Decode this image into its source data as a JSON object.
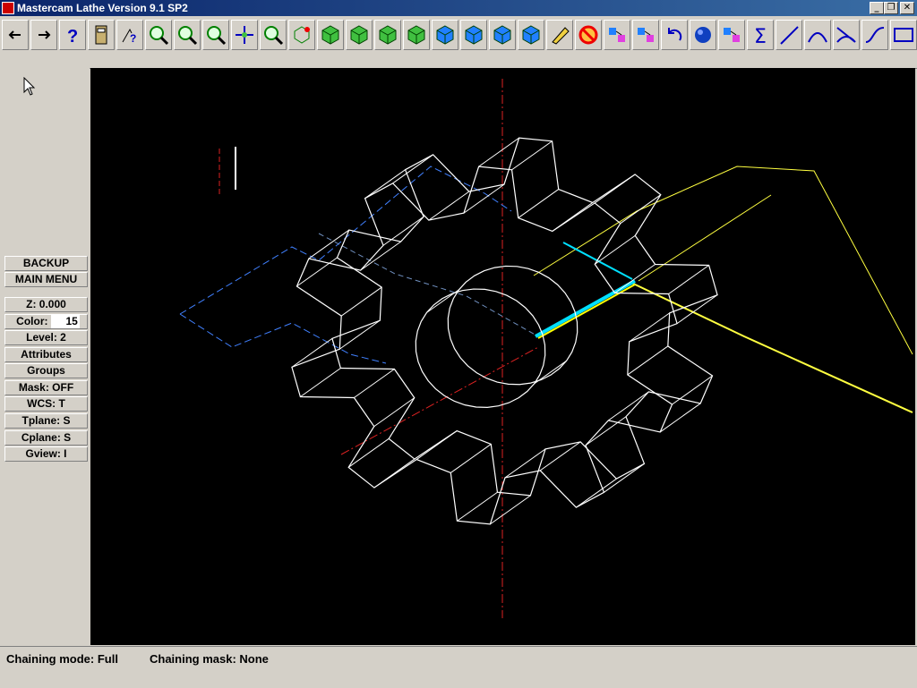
{
  "window": {
    "title": "Mastercam Lathe Version 9.1 SP2",
    "minimize": "_",
    "maximize": "❐",
    "close": "✕"
  },
  "toolbar": {
    "buttons": [
      "back-arrow-icon",
      "forward-arrow-icon",
      "help-icon",
      "calculator-icon",
      "analyze-icon",
      "zoom-icon",
      "unzoom-icon",
      "zoom-previous-icon",
      "pan-icon",
      "window-zoom-icon",
      "rotate-icon",
      "view-top-icon",
      "view-front-icon",
      "view-side-icon",
      "view-iso-icon",
      "cplane-top-icon",
      "cplane-front-icon",
      "cplane-side-icon",
      "cplane-3d-icon",
      "delete-icon",
      "no-entry-icon",
      "xform-translate-icon",
      "xform-mirror-icon",
      "undo-icon",
      "shade-icon",
      "chain-icon",
      "sum-icon",
      "line-icon",
      "arc-icon",
      "trim-icon",
      "spline-icon",
      "rectangle-icon"
    ]
  },
  "sidebar": {
    "backup": "BACKUP",
    "main_menu": "MAIN MENU",
    "z": "Z:  0.000",
    "color_label": "Color:",
    "color_value": "15",
    "level": "Level:  2",
    "attributes": "Attributes",
    "groups": "Groups",
    "mask": "Mask:  OFF",
    "wcs": "WCS:   T",
    "tplane": "Tplane:  S",
    "cplane": "Cplane:  S",
    "gview": "Gview:   I"
  },
  "status": {
    "chaining_mode": "Chaining mode: Full",
    "chaining_mask": "Chaining mask: None"
  },
  "colors": {
    "canvas": "#000000",
    "geometry": "#ffffff",
    "axis": "#ff0000",
    "toolpath": "#ffff00",
    "highlight": "#00ffff",
    "dashed": "#4080ff"
  }
}
